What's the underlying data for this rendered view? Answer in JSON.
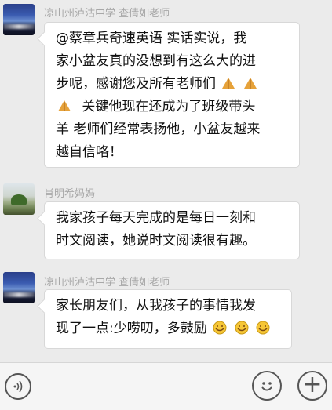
{
  "messages": [
    {
      "sender": "凉山州泸沽中学 查倩如老师",
      "lines": [
        "@蔡章兵奇速英语   实话实说，我",
        "家小盆友真的没想到有这么大的进",
        "步呢，感谢您及所有老师们",
        "关键他现在还成为了班级带头",
        "羊 老师们经常表扬他，小盆友越来",
        "越自信咯！"
      ],
      "emojis": [
        "pray-emoji",
        "pray-emoji",
        "pray-emoji"
      ]
    },
    {
      "sender": "肖明希妈妈",
      "lines": [
        "我家孩子每天完成的是每日一刻和",
        "时文阅读，她说时文阅读很有趣。"
      ]
    },
    {
      "sender": "凉山州泸沽中学 查倩如老师",
      "lines": [
        "家长朋友们，从我孩子的事情我发",
        "现了一点:少唠叨，多鼓励"
      ],
      "emojis": [
        "grin-emoji",
        "grin-emoji",
        "grin-emoji"
      ]
    }
  ],
  "input_bar": {
    "voice_icon": "voice-icon",
    "emoji_icon": "emoji-icon",
    "plus_icon": "plus-icon",
    "plus_glyph": "+"
  },
  "colors": {
    "background": "#ebebeb",
    "bubble": "#ffffff",
    "sender": "#a8a8a8"
  }
}
